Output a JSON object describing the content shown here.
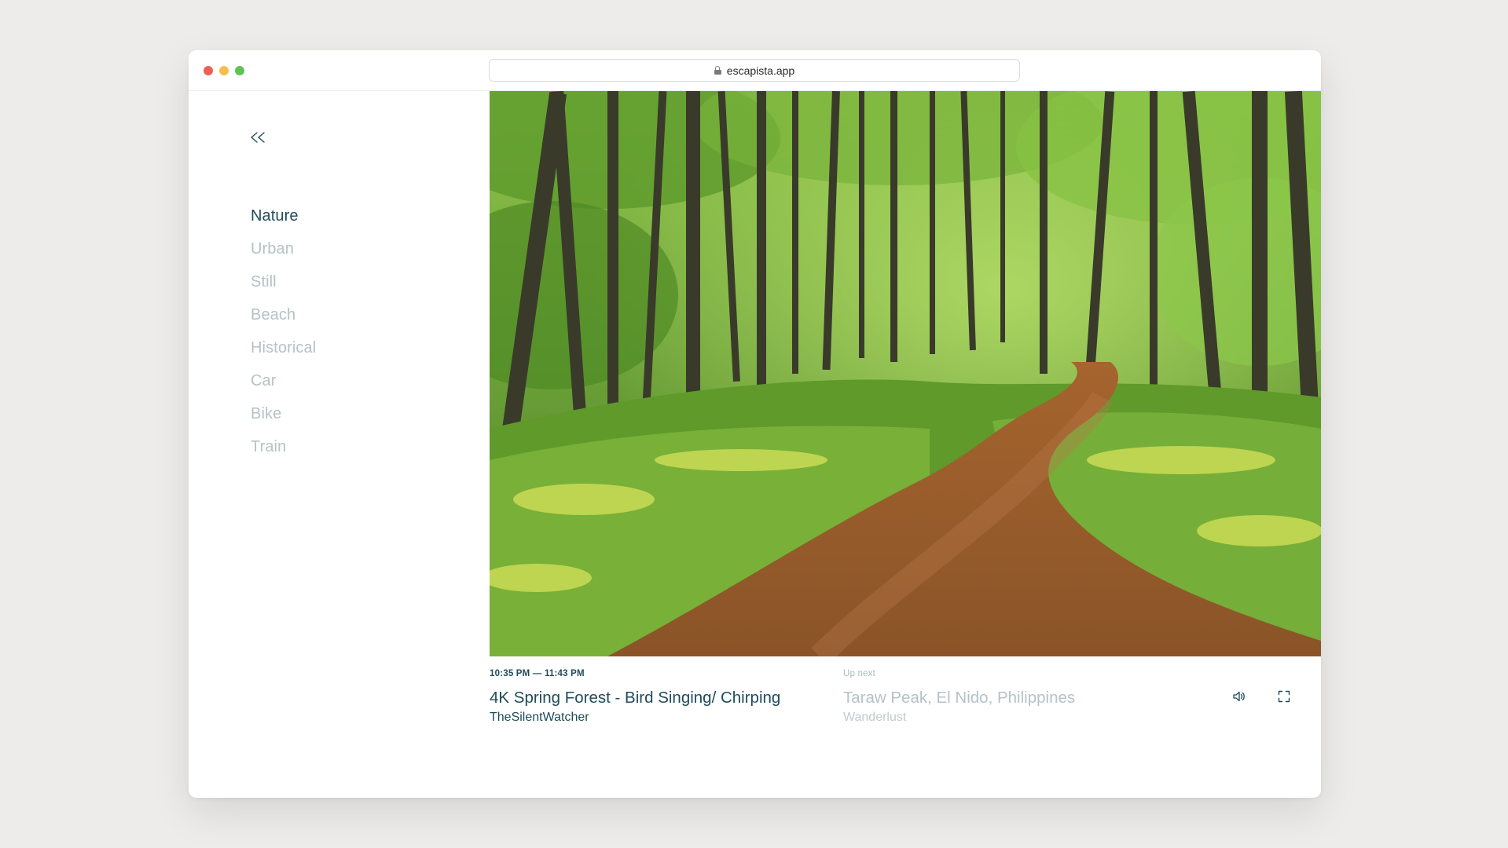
{
  "browser": {
    "url": "escapista.app"
  },
  "sidebar": {
    "collapse_icon": "double-chevron-left-icon",
    "items": [
      {
        "label": "Nature",
        "active": true
      },
      {
        "label": "Urban",
        "active": false
      },
      {
        "label": "Still",
        "active": false
      },
      {
        "label": "Beach",
        "active": false
      },
      {
        "label": "Historical",
        "active": false
      },
      {
        "label": "Car",
        "active": false
      },
      {
        "label": "Bike",
        "active": false
      },
      {
        "label": "Train",
        "active": false
      }
    ]
  },
  "player": {
    "image_description": "forest-path-video-frame",
    "current": {
      "time_range": "10:35 PM — 11:43 PM",
      "title": "4K Spring Forest - Bird Singing/ Chirping",
      "channel": "TheSilentWatcher"
    },
    "up_next": {
      "label": "Up next",
      "title": "Taraw Peak, El Nido, Philippines",
      "channel": "Wanderlust"
    },
    "controls": {
      "volume_icon": "speaker-icon",
      "fullscreen_icon": "fullscreen-icon"
    }
  },
  "colors": {
    "accent": "#1f4b5a",
    "muted": "#b5c2c6",
    "background": "#edecea"
  }
}
